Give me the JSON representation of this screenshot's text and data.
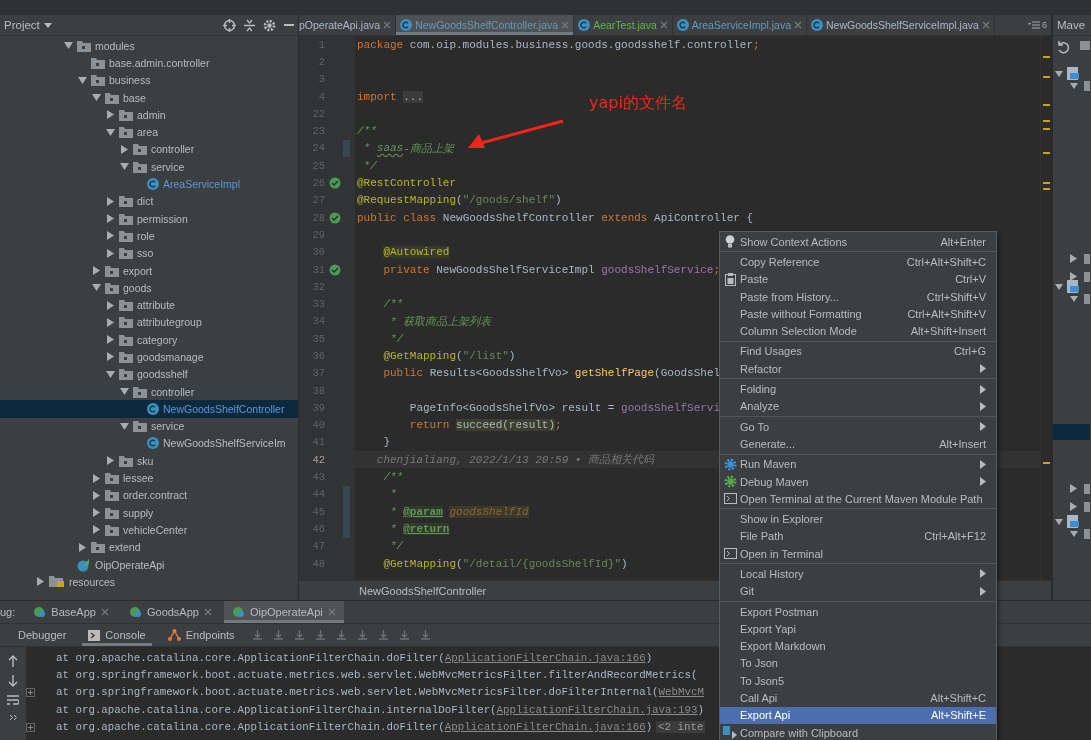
{
  "project_panel": {
    "title": "Project",
    "items": [
      {
        "name": "modules",
        "kind": "package",
        "expanded": true,
        "selected": false,
        "children": [
          {
            "name": "base.admin.controller",
            "kind": "package",
            "selected": false
          },
          {
            "name": "business",
            "kind": "package",
            "expanded": true,
            "selected": false,
            "children": [
              {
                "name": "base",
                "kind": "package",
                "expanded": true,
                "selected": false,
                "children": [
                  {
                    "name": "admin",
                    "kind": "package",
                    "expanded": false,
                    "selected": false
                  },
                  {
                    "name": "area",
                    "kind": "package",
                    "expanded": true,
                    "selected": false,
                    "children": [
                      {
                        "name": "controller",
                        "kind": "package",
                        "expanded": false,
                        "selected": false
                      },
                      {
                        "name": "service",
                        "kind": "package",
                        "expanded": true,
                        "selected": false,
                        "children": [
                          {
                            "name": "AreaServiceImpl",
                            "kind": "class",
                            "modified": true,
                            "selected": false
                          }
                        ]
                      }
                    ]
                  },
                  {
                    "name": "dict",
                    "kind": "package",
                    "expanded": false,
                    "selected": false
                  },
                  {
                    "name": "permission",
                    "kind": "package",
                    "expanded": false,
                    "selected": false
                  },
                  {
                    "name": "role",
                    "kind": "package",
                    "expanded": false,
                    "selected": false
                  },
                  {
                    "name": "sso",
                    "kind": "package",
                    "expanded": false,
                    "selected": false
                  }
                ]
              },
              {
                "name": "export",
                "kind": "package",
                "expanded": false,
                "selected": false
              },
              {
                "name": "goods",
                "kind": "package",
                "expanded": true,
                "selected": false,
                "children": [
                  {
                    "name": "attribute",
                    "kind": "package",
                    "expanded": false,
                    "selected": false
                  },
                  {
                    "name": "attributegroup",
                    "kind": "package",
                    "expanded": false,
                    "selected": false
                  },
                  {
                    "name": "category",
                    "kind": "package",
                    "expanded": false,
                    "selected": false
                  },
                  {
                    "name": "goodsmanage",
                    "kind": "package",
                    "expanded": false,
                    "selected": false
                  },
                  {
                    "name": "goodsshelf",
                    "kind": "package",
                    "expanded": true,
                    "selected": false,
                    "children": [
                      {
                        "name": "controller",
                        "kind": "package",
                        "expanded": true,
                        "selected": false,
                        "children": [
                          {
                            "name": "NewGoodsShelfController",
                            "kind": "class",
                            "modified": true,
                            "selected": true
                          }
                        ]
                      },
                      {
                        "name": "service",
                        "kind": "package",
                        "expanded": true,
                        "selected": false,
                        "children": [
                          {
                            "name": "NewGoodsShelfServiceIm",
                            "kind": "class",
                            "modified": false,
                            "selected": false
                          }
                        ]
                      }
                    ]
                  },
                  {
                    "name": "sku",
                    "kind": "package",
                    "expanded": false,
                    "selected": false
                  }
                ]
              },
              {
                "name": "lessee",
                "kind": "package",
                "expanded": false,
                "selected": false
              },
              {
                "name": "order.contract",
                "kind": "package",
                "expanded": false,
                "selected": false
              },
              {
                "name": "supply",
                "kind": "package",
                "expanded": false,
                "selected": false
              },
              {
                "name": "vehicleCenter",
                "kind": "package",
                "expanded": false,
                "selected": false
              }
            ]
          },
          {
            "name": "extend",
            "kind": "package",
            "expanded": false,
            "selected": false
          }
        ]
      },
      {
        "name": "OipOperateApi",
        "kind": "app",
        "selected": false
      }
    ],
    "outer_items": [
      {
        "name": "resources",
        "kind": "resources",
        "expanded": false,
        "selected": false
      }
    ]
  },
  "editor_tabs": [
    {
      "label": "pOperateApi.java",
      "icon": false,
      "color": "#a9b7c6",
      "selected": false
    },
    {
      "label": "NewGoodsShelfController.java",
      "icon": true,
      "color": "#6897bb",
      "selected": true
    },
    {
      "label": "AearTest.java",
      "icon": true,
      "color": "#62b543",
      "selected": false
    },
    {
      "label": "AreaServiceImpl.java",
      "icon": true,
      "color": "#6897bb",
      "selected": false
    },
    {
      "label": "NewGoodsShelfServiceImpl.java",
      "icon": true,
      "color": "#a9b7c6",
      "selected": false
    }
  ],
  "tab_overflow_count": "6",
  "code_lines": [
    {
      "number": "1",
      "tokens": [
        {
          "kind": "kw",
          "t": "package "
        },
        {
          "kind": "plain",
          "t": "com.oip.modules.business.goods.goodsshelf.controller"
        },
        {
          "kind": "kw",
          "t": ";"
        }
      ]
    },
    {
      "number": "2"
    },
    {
      "number": "3"
    },
    {
      "number": "4",
      "tokens": [
        {
          "kind": "kw",
          "t": "import "
        },
        {
          "kind": "fold",
          "t": "..."
        }
      ]
    },
    {
      "number": "22"
    },
    {
      "number": "23",
      "tokens": [
        {
          "kind": "doc",
          "t": "/**"
        }
      ]
    },
    {
      "number": "24",
      "changed": true,
      "tokens": [
        {
          "kind": "doc",
          "t": " * "
        },
        {
          "kind": "docu",
          "t": "saas"
        },
        {
          "kind": "doc",
          "t": "-商品上架"
        }
      ]
    },
    {
      "number": "25",
      "tokens": [
        {
          "kind": "doc",
          "t": " */"
        }
      ]
    },
    {
      "number": "26",
      "gutter_icon": true,
      "tokens": [
        {
          "kind": "ann",
          "t": "@RestController"
        }
      ]
    },
    {
      "number": "27",
      "tokens": [
        {
          "kind": "ann",
          "t": "@RequestMapping"
        },
        {
          "kind": "plain",
          "t": "("
        },
        {
          "kind": "str",
          "t": "\"/goods/shelf\""
        },
        {
          "kind": "plain",
          "t": ")"
        }
      ]
    },
    {
      "number": "28",
      "gutter_icon": true,
      "tokens": [
        {
          "kind": "kw",
          "t": "public class "
        },
        {
          "kind": "plain",
          "t": "NewGoodsShelfController "
        },
        {
          "kind": "kw",
          "t": "extends "
        },
        {
          "kind": "plain",
          "t": "ApiController {"
        }
      ]
    },
    {
      "number": "29"
    },
    {
      "number": "30",
      "tokens": [
        {
          "kind": "annhl",
          "t": "    @Autowired"
        }
      ]
    },
    {
      "number": "31",
      "gutter_icon": true,
      "tokens": [
        {
          "kind": "kw",
          "t": "    private "
        },
        {
          "kind": "plain",
          "t": "NewGoodsShelfServiceImpl "
        },
        {
          "kind": "field",
          "t": "goodsShelfService"
        },
        {
          "kind": "kw",
          "t": ";"
        }
      ]
    },
    {
      "number": "32"
    },
    {
      "number": "33",
      "tokens": [
        {
          "kind": "doc",
          "t": "    /**"
        }
      ]
    },
    {
      "number": "34",
      "tokens": [
        {
          "kind": "doc",
          "t": "     * 获取商品上架列表"
        }
      ]
    },
    {
      "number": "35",
      "tokens": [
        {
          "kind": "doc",
          "t": "     */"
        }
      ]
    },
    {
      "number": "36",
      "tokens": [
        {
          "kind": "ann",
          "t": "    @GetMapping"
        },
        {
          "kind": "plain",
          "t": "("
        },
        {
          "kind": "str",
          "t": "\"/list\""
        },
        {
          "kind": "plain",
          "t": ")"
        }
      ]
    },
    {
      "number": "37",
      "tokens": [
        {
          "kind": "kw",
          "t": "    public "
        },
        {
          "kind": "plain",
          "t": "Results<GoodsShelfVo> "
        },
        {
          "kind": "fn",
          "t": "getShelfPage"
        },
        {
          "kind": "plain",
          "t": "(GoodsShel"
        }
      ]
    },
    {
      "number": "38"
    },
    {
      "number": "39",
      "tokens": [
        {
          "kind": "plain",
          "t": "        PageInfo<GoodsShelfVo> result = "
        },
        {
          "kind": "field",
          "t": "goodsShelfServi"
        }
      ]
    },
    {
      "number": "40",
      "tokens": [
        {
          "kind": "kw",
          "t": "        return "
        },
        {
          "kind": "hl",
          "t": "succeed(result)"
        },
        {
          "kind": "kw",
          "t": ";"
        }
      ]
    },
    {
      "number": "41",
      "tokens": [
        {
          "kind": "plain",
          "t": "    }"
        }
      ]
    },
    {
      "number": "42",
      "kind": "blame",
      "tokens": [
        {
          "kind": "blame",
          "t": "   chenjialiang, 2022/1/13 20:59 • 商品相关代码"
        }
      ]
    },
    {
      "number": "43",
      "tokens": [
        {
          "kind": "doc",
          "t": "    /**"
        }
      ]
    },
    {
      "number": "44",
      "changed": true,
      "tokens": [
        {
          "kind": "doc",
          "t": "     *"
        }
      ]
    },
    {
      "number": "45",
      "changed": true,
      "tokens": [
        {
          "kind": "doc",
          "t": "     * "
        },
        {
          "kind": "tag",
          "t": "@param"
        },
        {
          "kind": "param",
          "t": " goodsShelfId"
        }
      ]
    },
    {
      "number": "46",
      "changed": true,
      "tokens": [
        {
          "kind": "doc",
          "t": "     * "
        },
        {
          "kind": "tag",
          "t": "@return"
        }
      ]
    },
    {
      "number": "47",
      "tokens": [
        {
          "kind": "doc",
          "t": "     */"
        }
      ]
    },
    {
      "number": "48",
      "tokens": [
        {
          "kind": "ann",
          "t": "    @GetMapping"
        },
        {
          "kind": "plain",
          "t": "("
        },
        {
          "kind": "str",
          "t": "\"/detail/{goodsShelfId}\""
        },
        {
          "kind": "plain",
          "t": ")"
        }
      ]
    }
  ],
  "annotation": {
    "text": "yapi的文件名"
  },
  "breadcrumb": "NewGoodsShelfController",
  "maven_panel": {
    "title": "Mave"
  },
  "debug": {
    "label": "ug:",
    "tabs": [
      {
        "label": "BaseApp",
        "selected": false
      },
      {
        "label": "GoodsApp",
        "selected": false
      },
      {
        "label": "OipOperateApi",
        "selected": true
      }
    ],
    "views": [
      {
        "label": "Debugger",
        "selected": false
      },
      {
        "label": "Console",
        "selected": true
      },
      {
        "label": "Endpoints",
        "selected": false
      }
    ],
    "console_lines": [
      {
        "fold": false,
        "tokens": [
          {
            "kind": "plain",
            "t": "at org.apache.catalina.core.ApplicationFilterChain.doFilter("
          },
          {
            "kind": "link",
            "t": "ApplicationFilterChain.java:166"
          },
          {
            "kind": "plain",
            "t": ")"
          }
        ]
      },
      {
        "fold": false,
        "tokens": [
          {
            "kind": "plain",
            "t": "at org.springframework.boot.actuate.metrics.web.servlet.WebMvcMetricsFilter.filterAndRecordMetrics("
          }
        ]
      },
      {
        "fold": true,
        "tokens": [
          {
            "kind": "plain",
            "t": "at org.springframework.boot.actuate.metrics.web.servlet.WebMvcMetricsFilter.doFilterInternal("
          },
          {
            "kind": "link",
            "t": "WebMvcM"
          }
        ]
      },
      {
        "fold": false,
        "tokens": [
          {
            "kind": "plain",
            "t": "at org.apache.catalina.core.ApplicationFilterChain.internalDoFilter("
          },
          {
            "kind": "link",
            "t": "ApplicationFilterChain.java:193"
          },
          {
            "kind": "plain",
            "t": ")"
          }
        ]
      },
      {
        "fold": true,
        "tokens": [
          {
            "kind": "plain",
            "t": "at org.apache.catalina.core.ApplicationFilterChain.doFilter("
          },
          {
            "kind": "link",
            "t": "ApplicationFilterChain.java:166"
          },
          {
            "kind": "plain",
            "t": ")"
          },
          {
            "kind": "hint",
            "t": "<2 inte"
          }
        ]
      }
    ]
  },
  "context_menu": {
    "groups": [
      [
        {
          "label": "Show Context Actions",
          "shortcut": "Alt+Enter",
          "kind": "lightbulb",
          "submenu": false,
          "selected": false
        }
      ],
      [
        {
          "label": "Copy Reference",
          "shortcut": "Ctrl+Alt+Shift+C",
          "submenu": false,
          "selected": false
        },
        {
          "label": "Paste",
          "shortcut": "Ctrl+V",
          "kind": "clipboard",
          "submenu": false,
          "selected": false
        },
        {
          "label": "Paste from History...",
          "shortcut": "Ctrl+Shift+V",
          "submenu": false,
          "selected": false
        },
        {
          "label": "Paste without Formatting",
          "shortcut": "Ctrl+Alt+Shift+V",
          "submenu": false,
          "selected": false
        },
        {
          "label": "Column Selection Mode",
          "shortcut": "Alt+Shift+Insert",
          "submenu": false,
          "selected": false
        }
      ],
      [
        {
          "label": "Find Usages",
          "shortcut": "Ctrl+G",
          "submenu": false,
          "selected": false
        },
        {
          "label": "Refactor",
          "submenu": true,
          "selected": false
        }
      ],
      [
        {
          "label": "Folding",
          "submenu": true,
          "selected": false
        },
        {
          "label": "Analyze",
          "submenu": true,
          "selected": false
        }
      ],
      [
        {
          "label": "Go To",
          "submenu": true,
          "selected": false
        },
        {
          "label": "Generate...",
          "shortcut": "Alt+Insert",
          "submenu": false,
          "selected": false
        }
      ],
      [
        {
          "label": "Run Maven",
          "kind": "run",
          "submenu": true,
          "selected": false
        },
        {
          "label": "Debug Maven",
          "kind": "debug",
          "submenu": true,
          "selected": false
        },
        {
          "label": "Open Terminal at the Current Maven Module Path",
          "kind": "terminal",
          "submenu": false,
          "selected": false
        }
      ],
      [
        {
          "label": "Show in Explorer",
          "submenu": false,
          "selected": false
        },
        {
          "label": "File Path",
          "shortcut": "Ctrl+Alt+F12",
          "submenu": false,
          "selected": false
        },
        {
          "label": "Open in Terminal",
          "kind": "terminal",
          "submenu": false,
          "selected": false
        }
      ],
      [
        {
          "label": "Local History",
          "submenu": true,
          "selected": false
        },
        {
          "label": "Git",
          "submenu": true,
          "selected": false
        }
      ],
      [
        {
          "label": "Export Postman",
          "submenu": false,
          "selected": false
        },
        {
          "label": "Export Yapi",
          "submenu": false,
          "selected": false
        },
        {
          "label": "Export Markdown",
          "submenu": false,
          "selected": false
        },
        {
          "label": "To Json",
          "submenu": false,
          "selected": false
        },
        {
          "label": "To Json5",
          "submenu": false,
          "selected": false
        },
        {
          "label": "Call Api",
          "shortcut": "Alt+Shift+C",
          "submenu": false,
          "selected": false
        },
        {
          "label": "Export Api",
          "shortcut": "Alt+Shift+E",
          "submenu": false,
          "selected": true
        },
        {
          "label": "Compare with Clipboard",
          "kind": "compare",
          "submenu": false,
          "selected": false
        }
      ]
    ]
  }
}
